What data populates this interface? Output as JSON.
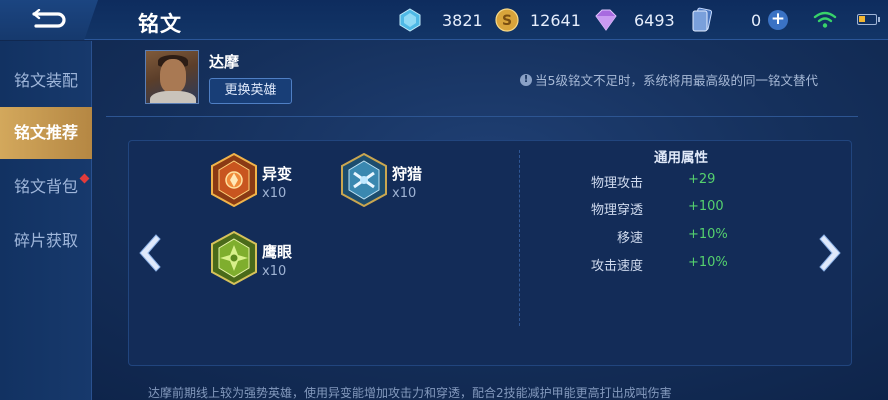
{
  "header": {
    "title": "铭文"
  },
  "currencies": [
    {
      "name": "diamond-icon",
      "value": "3821",
      "color": "#7fd4f2"
    },
    {
      "name": "gold-coin-icon",
      "value": "12641",
      "color": "#e9b64c"
    },
    {
      "name": "purple-crystal-icon",
      "value": "6493",
      "color": "#b07be8"
    },
    {
      "name": "card-icon",
      "value": "0",
      "color": "#7aa0db"
    }
  ],
  "status": {
    "wifi_color": "#38d36a",
    "battery_color": "#f2b633"
  },
  "sidebar": {
    "items": [
      {
        "label": "铭文装配",
        "active": false
      },
      {
        "label": "铭文推荐",
        "active": true
      },
      {
        "label": "铭文背包",
        "active": false
      },
      {
        "label": "碎片获取",
        "active": false
      }
    ]
  },
  "hero": {
    "name": "达摩",
    "change_label": "更换英雄"
  },
  "notice": {
    "text": "当5级铭文不足时，系统将用最高级的同一铭文替代"
  },
  "runes": [
    {
      "name": "异变",
      "count": "x10",
      "color": "red"
    },
    {
      "name": "狩猎",
      "count": "x10",
      "color": "blue"
    },
    {
      "name": "鹰眼",
      "count": "x10",
      "color": "green"
    }
  ],
  "stats": {
    "title": "通用属性",
    "rows": [
      {
        "name": "物理攻击",
        "value": "+29"
      },
      {
        "name": "物理穿透",
        "value": "+100"
      },
      {
        "name": "移速",
        "value": "+10%"
      },
      {
        "name": "攻击速度",
        "value": "+10%"
      }
    ]
  },
  "description": "达摩前期线上较为强势英雄，使用异变能增加攻击力和穿透，配合2技能减护甲能更高打出成吨伤害"
}
